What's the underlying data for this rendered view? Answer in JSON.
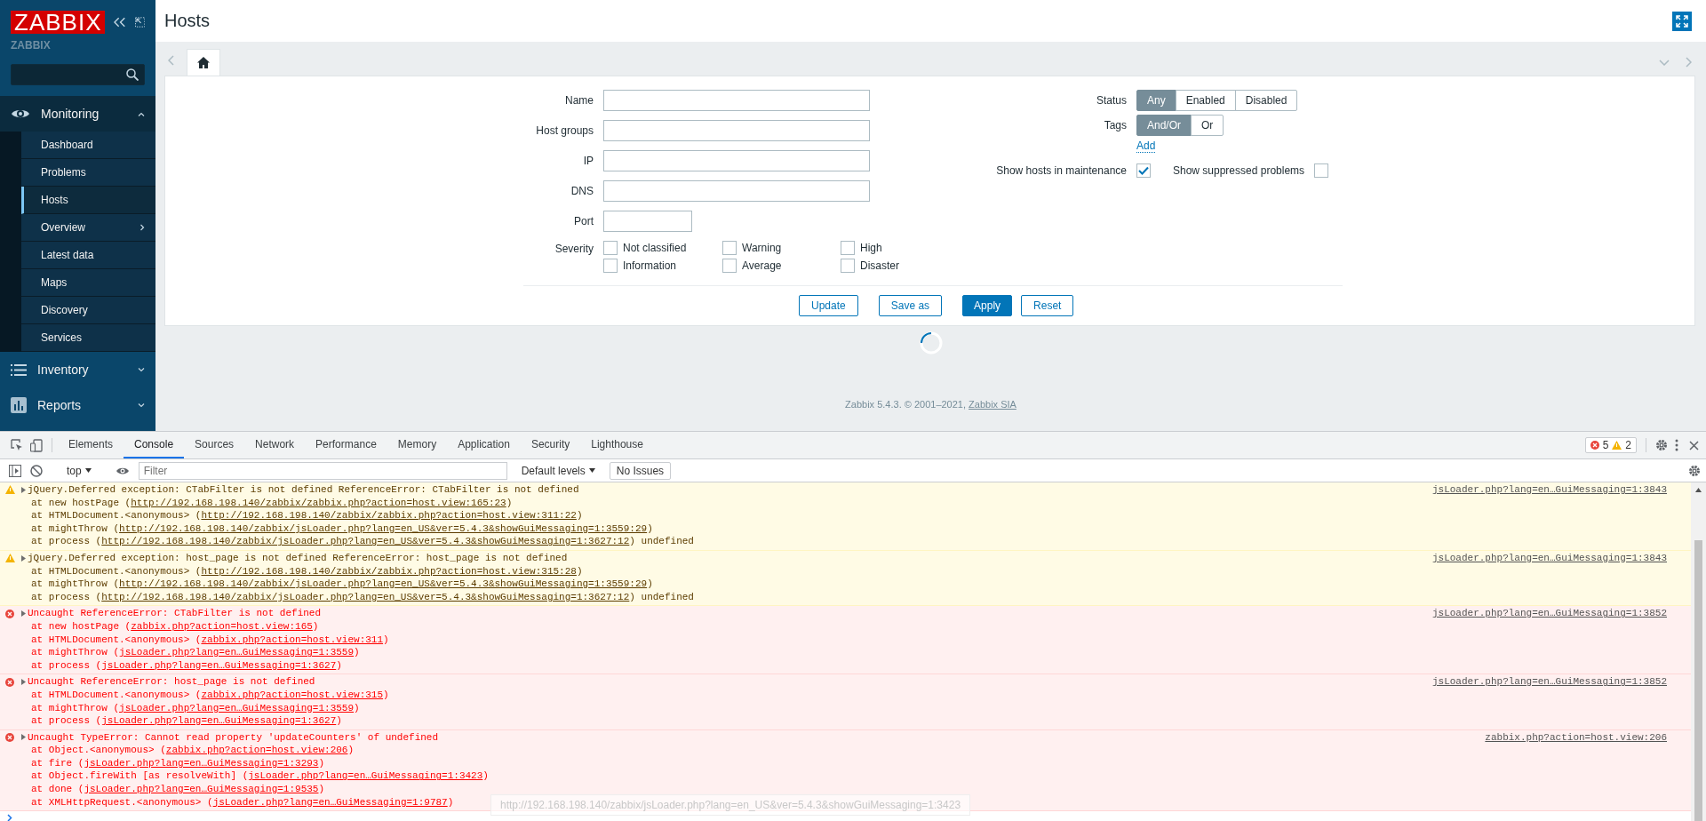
{
  "sidebar": {
    "logo": "ZABBIX",
    "server_name": "ZABBIX",
    "menu": [
      {
        "label": "Monitoring",
        "expanded": true,
        "children": [
          {
            "label": "Dashboard",
            "selected": false,
            "has_submenu": false
          },
          {
            "label": "Problems",
            "selected": false,
            "has_submenu": false
          },
          {
            "label": "Hosts",
            "selected": true,
            "has_submenu": false
          },
          {
            "label": "Overview",
            "selected": false,
            "has_submenu": true
          },
          {
            "label": "Latest data",
            "selected": false,
            "has_submenu": false
          },
          {
            "label": "Maps",
            "selected": false,
            "has_submenu": false
          },
          {
            "label": "Discovery",
            "selected": false,
            "has_submenu": false
          },
          {
            "label": "Services",
            "selected": false,
            "has_submenu": false
          }
        ]
      },
      {
        "label": "Inventory",
        "expanded": false
      },
      {
        "label": "Reports",
        "expanded": false
      }
    ]
  },
  "page": {
    "title": "Hosts"
  },
  "filter": {
    "fields": [
      {
        "label": "Name",
        "kind": "wide"
      },
      {
        "label": "Host groups",
        "kind": "wide"
      },
      {
        "label": "IP",
        "kind": "wide"
      },
      {
        "label": "DNS",
        "kind": "wide"
      },
      {
        "label": "Port",
        "kind": "short"
      }
    ],
    "severity": {
      "label": "Severity",
      "options": [
        {
          "label": "Not classified",
          "checked": false
        },
        {
          "label": "Warning",
          "checked": false
        },
        {
          "label": "High",
          "checked": false
        },
        {
          "label": "Information",
          "checked": false
        },
        {
          "label": "Average",
          "checked": false
        },
        {
          "label": "Disaster",
          "checked": false
        }
      ]
    },
    "status": {
      "label": "Status",
      "options": [
        {
          "label": "Any",
          "selected": true
        },
        {
          "label": "Enabled",
          "selected": false
        },
        {
          "label": "Disabled",
          "selected": false
        }
      ]
    },
    "tags": {
      "label": "Tags",
      "options": [
        {
          "label": "And/Or",
          "selected": true
        },
        {
          "label": "Or",
          "selected": false
        }
      ],
      "add_link": "Add"
    },
    "toggles": [
      {
        "label": "Show hosts in maintenance",
        "checked": true
      },
      {
        "label": "Show suppressed problems",
        "checked": false
      }
    ],
    "buttons": [
      {
        "label": "Update",
        "primary": false
      },
      {
        "label": "Save as",
        "primary": false
      },
      {
        "label": "Apply",
        "primary": true
      },
      {
        "label": "Reset",
        "primary": false
      }
    ]
  },
  "footer": {
    "text": "Zabbix 5.4.3. © 2001–2021, ",
    "link": "Zabbix SIA"
  },
  "devtools": {
    "tabs": [
      {
        "label": "Elements",
        "selected": false
      },
      {
        "label": "Console",
        "selected": true
      },
      {
        "label": "Sources",
        "selected": false
      },
      {
        "label": "Network",
        "selected": false
      },
      {
        "label": "Performance",
        "selected": false
      },
      {
        "label": "Memory",
        "selected": false
      },
      {
        "label": "Application",
        "selected": false
      },
      {
        "label": "Security",
        "selected": false
      },
      {
        "label": "Lighthouse",
        "selected": false
      }
    ],
    "error_count": "5",
    "warning_count": "2",
    "toolbar": {
      "context": "top",
      "filter_placeholder": "Filter",
      "levels": "Default levels",
      "issues": "No Issues"
    },
    "messages": [
      {
        "kind": "warning",
        "text": "jQuery.Deferred exception: CTabFilter is not defined ReferenceError: CTabFilter is not defined",
        "source": "jsLoader.php?lang=en…GuiMessaging=1:3843",
        "frames": [
          {
            "prefix": "at new hostPage (",
            "link": "http://192.168.198.140/zabbix/zabbix.php?action=host.view:165:23",
            "suffix": ")"
          },
          {
            "prefix": "at HTMLDocument.<anonymous> (",
            "link": "http://192.168.198.140/zabbix/zabbix.php?action=host.view:311:22",
            "suffix": ")"
          },
          {
            "prefix": "at mightThrow (",
            "link": "http://192.168.198.140/zabbix/jsLoader.php?lang=en_US&ver=5.4.3&showGuiMessaging=1:3559:29",
            "suffix": ")"
          },
          {
            "prefix": "at process (",
            "link": "http://192.168.198.140/zabbix/jsLoader.php?lang=en_US&ver=5.4.3&showGuiMessaging=1:3627:12",
            "suffix": ") undefined"
          }
        ]
      },
      {
        "kind": "warning",
        "text": "jQuery.Deferred exception: host_page is not defined ReferenceError: host_page is not defined",
        "source": "jsLoader.php?lang=en…GuiMessaging=1:3843",
        "frames": [
          {
            "prefix": "at HTMLDocument.<anonymous> (",
            "link": "http://192.168.198.140/zabbix/zabbix.php?action=host.view:315:28",
            "suffix": ")"
          },
          {
            "prefix": "at mightThrow (",
            "link": "http://192.168.198.140/zabbix/jsLoader.php?lang=en_US&ver=5.4.3&showGuiMessaging=1:3559:29",
            "suffix": ")"
          },
          {
            "prefix": "at process (",
            "link": "http://192.168.198.140/zabbix/jsLoader.php?lang=en_US&ver=5.4.3&showGuiMessaging=1:3627:12",
            "suffix": ") undefined"
          }
        ]
      },
      {
        "kind": "error",
        "text": "Uncaught ReferenceError: CTabFilter is not defined",
        "source": "jsLoader.php?lang=en…GuiMessaging=1:3852",
        "frames": [
          {
            "prefix": "at new hostPage (",
            "link": "zabbix.php?action=host.view:165",
            "suffix": ")"
          },
          {
            "prefix": "at HTMLDocument.<anonymous> (",
            "link": "zabbix.php?action=host.view:311",
            "suffix": ")"
          },
          {
            "prefix": "at mightThrow (",
            "link": "jsLoader.php?lang=en…GuiMessaging=1:3559",
            "suffix": ")"
          },
          {
            "prefix": "at process (",
            "link": "jsLoader.php?lang=en…GuiMessaging=1:3627",
            "suffix": ")"
          }
        ]
      },
      {
        "kind": "error",
        "text": "Uncaught ReferenceError: host_page is not defined",
        "source": "jsLoader.php?lang=en…GuiMessaging=1:3852",
        "frames": [
          {
            "prefix": "at HTMLDocument.<anonymous> (",
            "link": "zabbix.php?action=host.view:315",
            "suffix": ")"
          },
          {
            "prefix": "at mightThrow (",
            "link": "jsLoader.php?lang=en…GuiMessaging=1:3559",
            "suffix": ")"
          },
          {
            "prefix": "at process (",
            "link": "jsLoader.php?lang=en…GuiMessaging=1:3627",
            "suffix": ")"
          }
        ]
      },
      {
        "kind": "error",
        "text": "Uncaught TypeError: Cannot read property 'updateCounters' of undefined",
        "source": "zabbix.php?action=host.view:206",
        "frames": [
          {
            "prefix": "at Object.<anonymous> (",
            "link": "zabbix.php?action=host.view:206",
            "suffix": ")"
          },
          {
            "prefix": "at fire (",
            "link": "jsLoader.php?lang=en…GuiMessaging=1:3293",
            "suffix": ")"
          },
          {
            "prefix": "at Object.fireWith [as resolveWith] (",
            "link": "jsLoader.php?lang=en…GuiMessaging=1:3423",
            "suffix": ")"
          },
          {
            "prefix": "at done (",
            "link": "jsLoader.php?lang=en…GuiMessaging=1:9535",
            "suffix": ")"
          },
          {
            "prefix": "at XMLHttpRequest.<anonymous> (",
            "link": "jsLoader.php?lang=en…GuiMessaging=1:9787",
            "suffix": ")"
          }
        ]
      }
    ],
    "tooltip": "http://192.168.198.140/zabbix/jsLoader.php?lang=en_US&ver=5.4.3&showGuiMessaging=1:3423"
  }
}
